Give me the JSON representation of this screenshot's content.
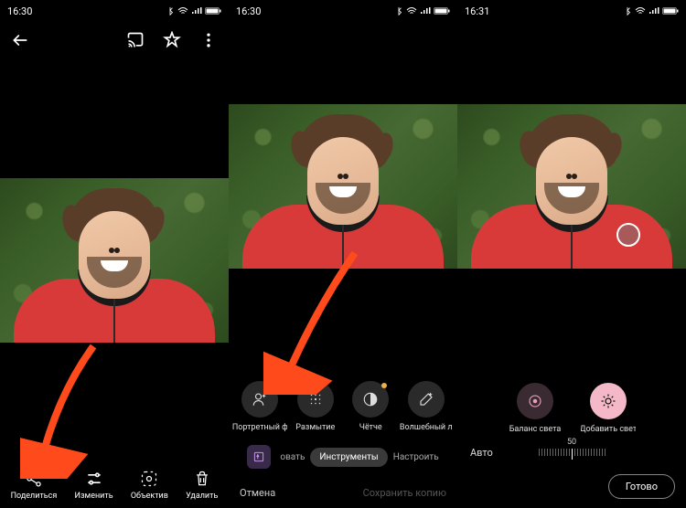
{
  "screen1": {
    "time": "16:30",
    "bottom": {
      "share": "Поделиться",
      "edit": "Изменить",
      "lens": "Объектив",
      "delete": "Удалить"
    }
  },
  "screen2": {
    "time": "16:30",
    "tools": {
      "portrait": "Портретный ф",
      "blur": "Размытие",
      "sharpen": "Чётче",
      "magic": "Волшебный л"
    },
    "tabs": {
      "crop": "овать",
      "tools": "Инструменты",
      "adjust": "Настроить"
    },
    "cancel": "Отмена",
    "save_copy": "Сохранить копию"
  },
  "screen3": {
    "time": "16:31",
    "tools": {
      "balance": "Баланс света",
      "add_light": "Добавить свет"
    },
    "slider_value": "50",
    "auto": "Авто",
    "done": "Готово"
  }
}
